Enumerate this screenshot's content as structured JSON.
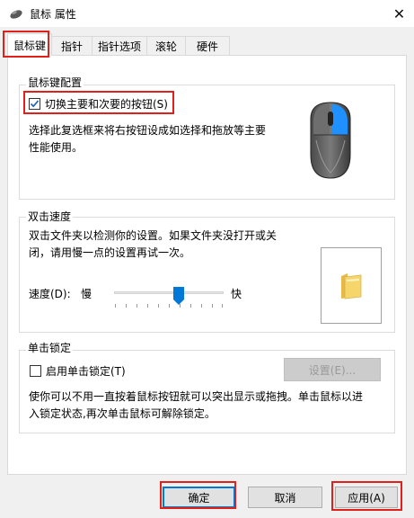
{
  "window": {
    "title": "鼠标 属性",
    "close_icon": "close-icon"
  },
  "tabs": [
    {
      "label": "鼠标键",
      "active": true
    },
    {
      "label": "指针",
      "active": false
    },
    {
      "label": "指针选项",
      "active": false
    },
    {
      "label": "滚轮",
      "active": false
    },
    {
      "label": "硬件",
      "active": false
    }
  ],
  "button_config": {
    "group_label": "鼠标键配置",
    "checkbox_label": "切换主要和次要的按钮(S)",
    "checked": true,
    "description_line1": "选择此复选框来将右按钮设成如选择和拖放等主要",
    "description_line2": "性能使用。"
  },
  "double_click": {
    "group_label": "双击速度",
    "description_line1": "双击文件夹以检测你的设置。如果文件夹没打开或关",
    "description_line2": "闭，请用慢一点的设置再试一次。",
    "speed_label": "速度(D):",
    "slow_label": "慢",
    "fast_label": "快",
    "slider_value_fraction": 0.6
  },
  "click_lock": {
    "group_label": "单击锁定",
    "checkbox_label": "启用单击锁定(T)",
    "checked": false,
    "settings_button": "设置(E)...",
    "description_line1": "使你可以不用一直按着鼠标按钮就可以突出显示或拖拽。单击鼠标以进",
    "description_line2": "入锁定状态,再次单击鼠标可解除锁定。"
  },
  "footer": {
    "ok": "确定",
    "cancel": "取消",
    "apply": "应用(A)"
  },
  "colors": {
    "highlight_box": "#e0201a",
    "mouse_button_blue": "#1e90ff",
    "folder_yellow": "#f6d66a"
  }
}
